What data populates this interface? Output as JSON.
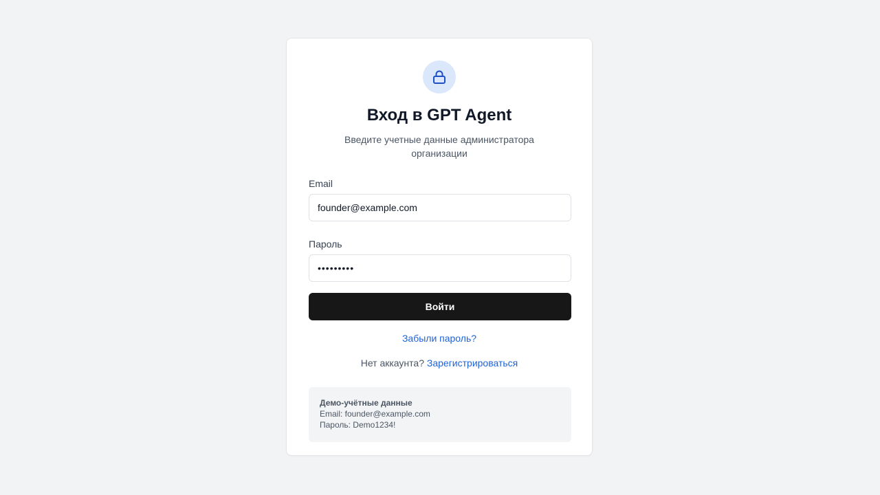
{
  "header": {
    "icon": "lock-icon",
    "title": "Вход в GPT Agent",
    "subtitle": "Введите учетные данные администратора организации"
  },
  "form": {
    "email_label": "Email",
    "email_value": "founder@example.com",
    "password_label": "Пароль",
    "password_value": "•••••••••",
    "submit_label": "Войти"
  },
  "links": {
    "forgot_password": "Забыли пароль?",
    "no_account": "Нет аккаунта?",
    "register": "Зарегистрироваться"
  },
  "demo": {
    "title": "Демо-учётные данные",
    "email_line": "Email: founder@example.com",
    "password_line": "Пароль: Demo1234!"
  },
  "colors": {
    "accent": "#1d63d8",
    "button": "#171717",
    "background": "#f2f3f5",
    "icon_bg": "#dbe7fb"
  }
}
